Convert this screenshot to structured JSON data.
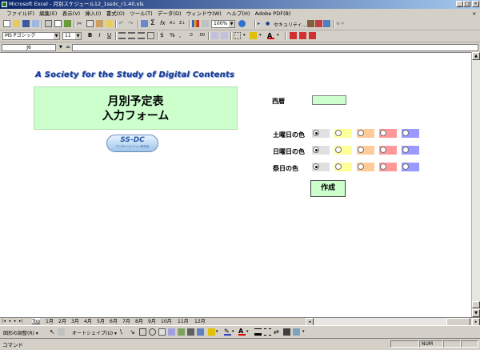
{
  "window": {
    "title": "Microsoft Excel - 月別スケジュール12_1ssdc_r1.40.xls",
    "minimize": "_",
    "restore": "□",
    "close": "×"
  },
  "menu": {
    "items": [
      "ファイル(F)",
      "編集(E)",
      "表示(V)",
      "挿入(I)",
      "書式(O)",
      "ツール(T)",
      "データ(D)",
      "ウィンドウ(W)",
      "ヘルプ(H)",
      "Adobe PDF(B)"
    ],
    "help_close": "×"
  },
  "toolbar": {
    "zoom": "100%",
    "security_label": "セキュリティ...",
    "font_name": "MS Pゴシック",
    "font_size": "11",
    "bold": "B",
    "italic": "I",
    "underline": "U"
  },
  "formula": {
    "name_box": "J6",
    "fx_symbol": "=",
    "value": ""
  },
  "sheet": {
    "society_name": "A Society for the Study of Digital Contents",
    "title_line1": "月別予定表",
    "title_line2": "入力フォーム",
    "logo_text": "SS-DC",
    "logo_subtext": "デジタルコンテンツ研究会",
    "year_label": "西暦",
    "year_value": "",
    "color_rows": [
      {
        "label": "土曜日の色",
        "selected": 0
      },
      {
        "label": "日曜日の色",
        "selected": 0
      },
      {
        "label": "祭日の色",
        "selected": 0
      }
    ],
    "swatch_colors": [
      "#e0e0e0",
      "#ffff99",
      "#ffcc99",
      "#ff9999",
      "#9999ff"
    ],
    "create_button": "作成"
  },
  "tabs": {
    "items": [
      "Top",
      "1月",
      "2月",
      "3月",
      "4月",
      "5月",
      "6月",
      "7月",
      "8月",
      "9月",
      "10月",
      "11月",
      "12月"
    ],
    "active": "Top"
  },
  "drawbar": {
    "adjust_label": "図形の調整(R) ▾",
    "autoshape_label": "オートシェイプ(U) ▾"
  },
  "status": {
    "mode": "コマンド",
    "num": "NUM"
  }
}
